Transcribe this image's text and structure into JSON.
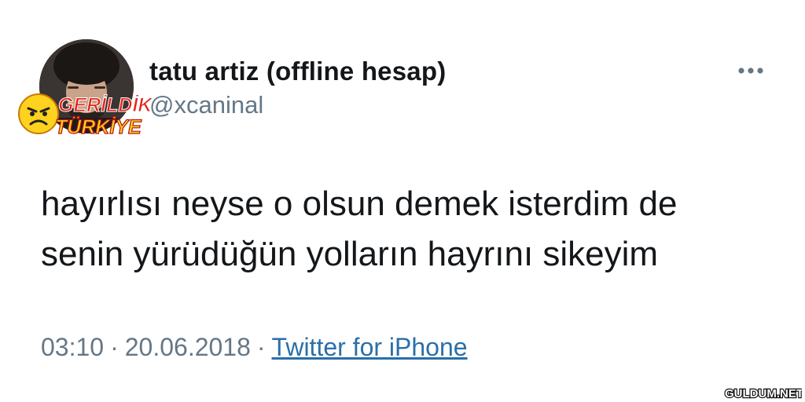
{
  "tweet": {
    "display_name": "tatu artiz (offline hesap)",
    "handle": "@xcaninal",
    "text": "hayırlısı neyse o olsun demek isterdim de\nsenin yürüdüğün yolların hayrını sikeyim",
    "time": "03:10",
    "separator": "·",
    "date": "20.06.2018",
    "source": "Twitter for iPhone"
  },
  "icons": {
    "avatar": "avatar",
    "more": "more-horizontal-icon",
    "watermark_badge": "angry-face-icon"
  },
  "watermark": {
    "line1": "GERİLDİK",
    "line2": "TÜRKİYE"
  },
  "site_logo": {
    "text": "GULDUM.NET"
  },
  "colors": {
    "text_primary": "#14171a",
    "text_secondary": "#657786",
    "link": "#2b6fa8",
    "watermark_red": "#e2231a",
    "watermark_yellow": "#ffd21f"
  }
}
